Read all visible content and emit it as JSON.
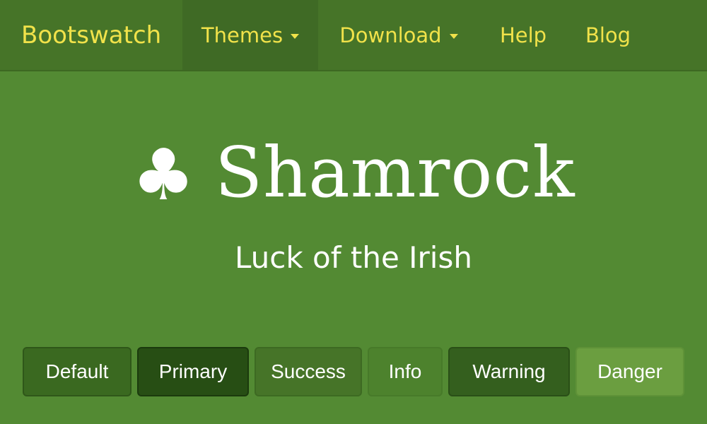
{
  "navbar": {
    "brand": "Bootswatch",
    "items": [
      {
        "label": "Themes",
        "has_caret": true,
        "active": true
      },
      {
        "label": "Download",
        "has_caret": true,
        "active": false
      },
      {
        "label": "Help",
        "has_caret": false,
        "active": false
      },
      {
        "label": "Blog",
        "has_caret": false,
        "active": false
      }
    ]
  },
  "hero": {
    "icon": "club-icon",
    "title": "Shamrock",
    "tagline": "Luck of the Irish"
  },
  "buttons": [
    {
      "label": "Default"
    },
    {
      "label": "Primary"
    },
    {
      "label": "Success"
    },
    {
      "label": "Info"
    },
    {
      "label": "Warning"
    },
    {
      "label": "Danger"
    }
  ],
  "colors": {
    "background": "#538a33",
    "navbar": "#467428",
    "nav_text": "#f1e24a",
    "hero_text": "#ffffff"
  }
}
